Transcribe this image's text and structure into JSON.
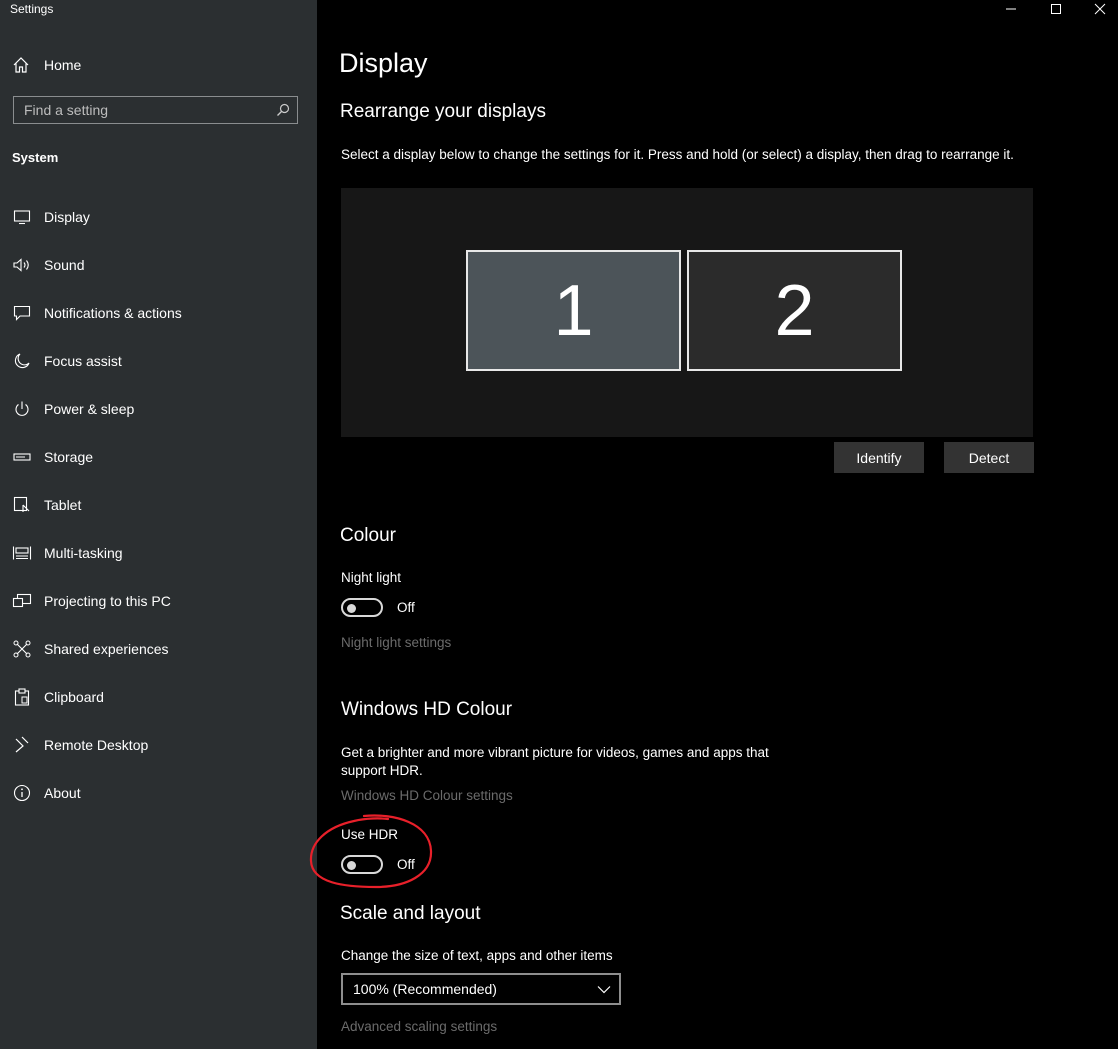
{
  "app": {
    "title": "Settings"
  },
  "sidebar": {
    "home_label": "Home",
    "search_placeholder": "Find a setting",
    "section_label": "System",
    "items": [
      {
        "label": "Display",
        "icon": "monitor-icon"
      },
      {
        "label": "Sound",
        "icon": "speaker-icon"
      },
      {
        "label": "Notifications & actions",
        "icon": "message-icon"
      },
      {
        "label": "Focus assist",
        "icon": "moon-icon"
      },
      {
        "label": "Power & sleep",
        "icon": "power-icon"
      },
      {
        "label": "Storage",
        "icon": "drive-icon"
      },
      {
        "label": "Tablet",
        "icon": "tablet-icon"
      },
      {
        "label": "Multi-tasking",
        "icon": "multitask-icon"
      },
      {
        "label": "Projecting to this PC",
        "icon": "project-icon"
      },
      {
        "label": "Shared experiences",
        "icon": "shared-icon"
      },
      {
        "label": "Clipboard",
        "icon": "clipboard-icon"
      },
      {
        "label": "Remote Desktop",
        "icon": "remote-icon"
      },
      {
        "label": "About",
        "icon": "info-icon"
      }
    ]
  },
  "main": {
    "page_title": "Display",
    "rearrange": {
      "heading": "Rearrange your displays",
      "description": "Select a display below to change the settings for it. Press and hold (or select) a display, then drag to rearrange it.",
      "display_1": "1",
      "display_2": "2",
      "identify_label": "Identify",
      "detect_label": "Detect"
    },
    "colour": {
      "heading": "Colour",
      "night_light_label": "Night light",
      "night_light_state": "Off",
      "night_light_settings_link": "Night light settings"
    },
    "hd_colour": {
      "heading": "Windows HD Colour",
      "description_line1": "Get a brighter and more vibrant picture for videos, games and apps that",
      "description_line2": "support HDR.",
      "settings_link": "Windows HD Colour settings",
      "use_hdr_label": "Use HDR",
      "use_hdr_state": "Off"
    },
    "scale": {
      "heading": "Scale and layout",
      "size_label": "Change the size of text, apps and other items",
      "size_value": "100% (Recommended)",
      "advanced_link": "Advanced scaling settings"
    }
  },
  "colors": {
    "sidebar_bg": "#2b2f31",
    "main_bg": "#000000",
    "annotation": "#e8202a"
  }
}
